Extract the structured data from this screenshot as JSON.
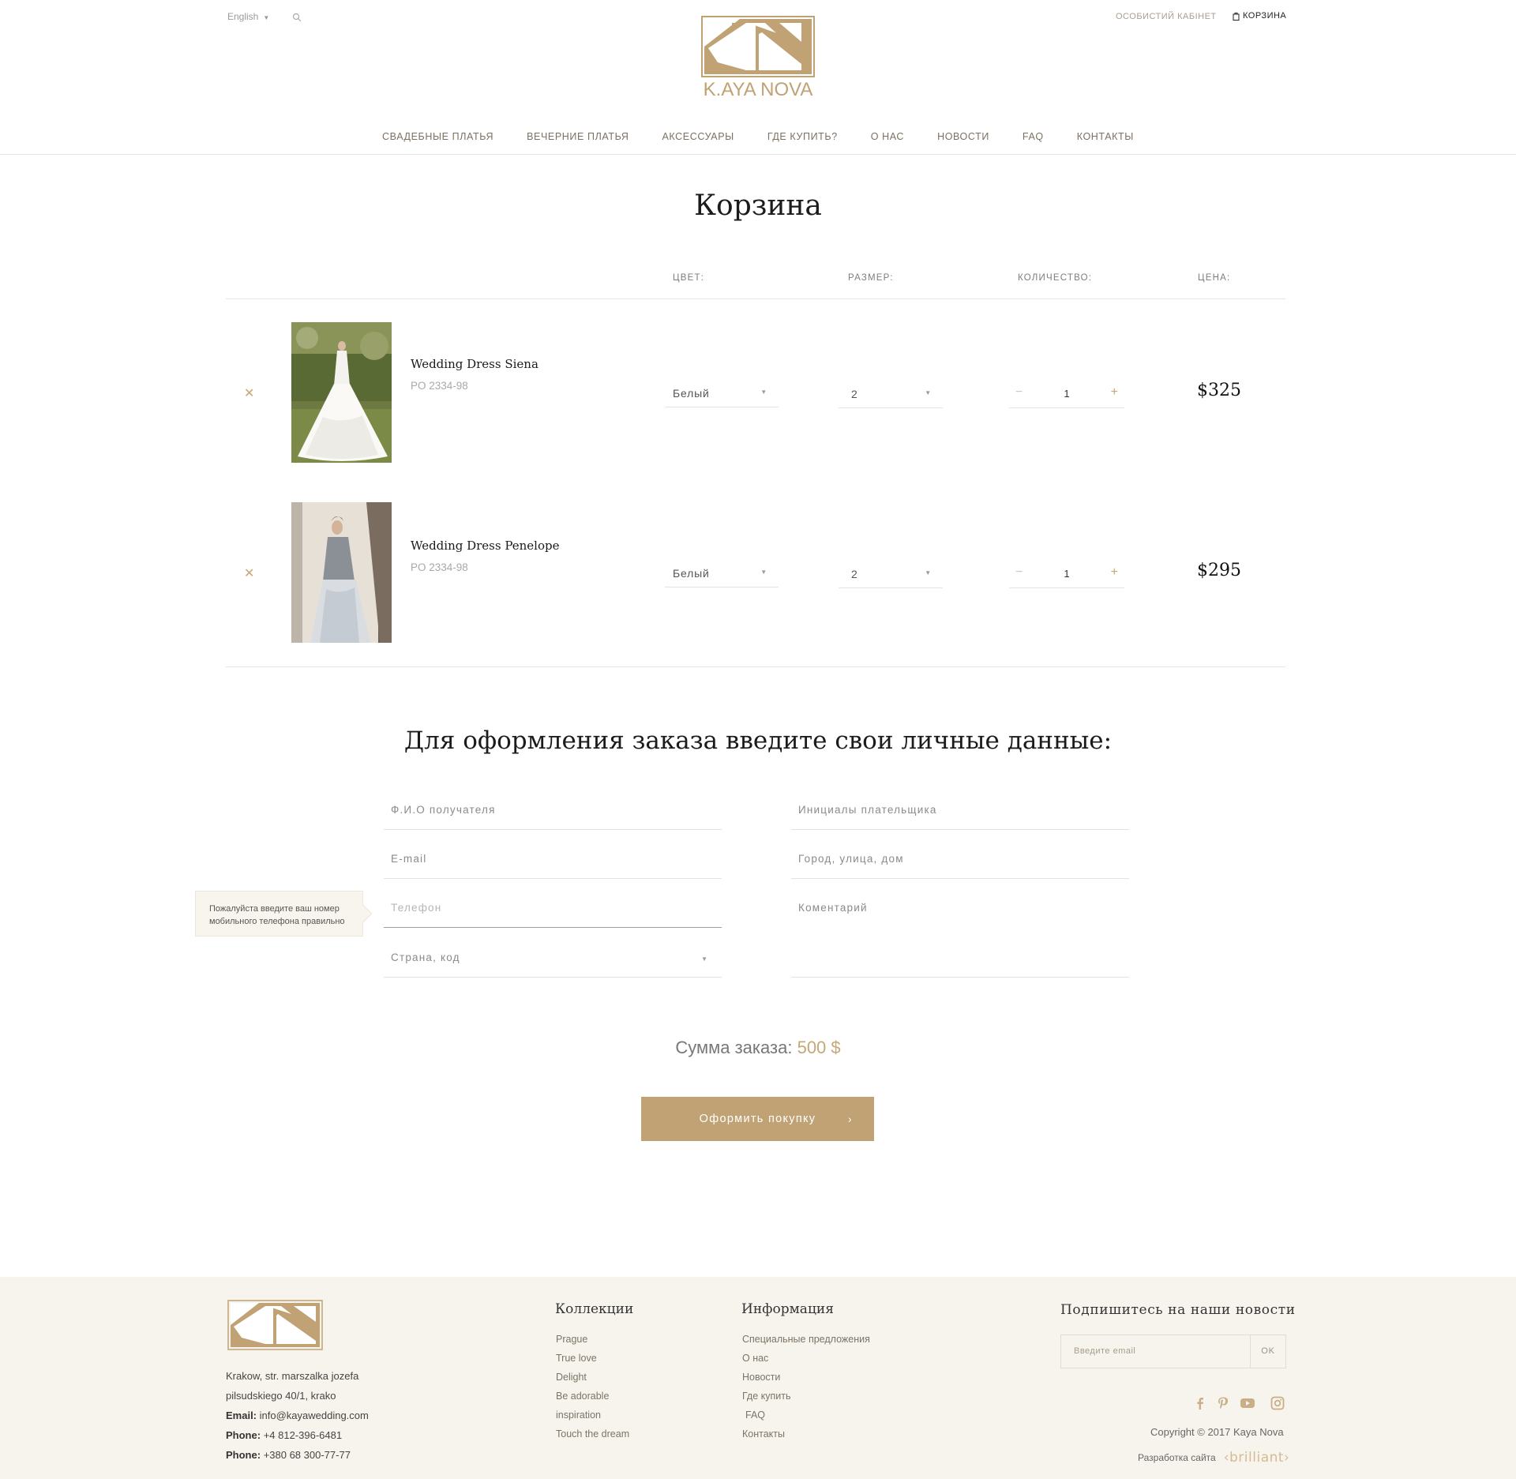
{
  "header": {
    "language": "English",
    "cabinet_link": "ОСОБИСТИЙ КАБІНЕТ",
    "cart_link": "КОРЗИНА",
    "logo_text": "KayaNova",
    "nav": [
      "СВАДЕБНЫЕ ПЛАТЬЯ",
      "ВЕЧЕРНИЕ ПЛАТЬЯ",
      "АКСЕССУАРЫ",
      "ГДЕ КУПИТЬ?",
      "О НАС",
      "НОВОСТИ",
      "FAQ",
      "КОНТАКТЫ"
    ]
  },
  "cart": {
    "title": "Корзина",
    "columns": {
      "color": "ЦВЕТ:",
      "size": "РАЗМЕР:",
      "quantity": "КОЛИЧЕСТВО:",
      "price": "ЦЕНА:"
    },
    "items": [
      {
        "name": "Wedding Dress Siena",
        "sku": "PO 2334-98",
        "color": "Белый",
        "size": "2",
        "quantity": "1",
        "price": "$325"
      },
      {
        "name": "Wedding Dress Penelope",
        "sku": "PO 2334-98",
        "color": "Белый",
        "size": "2",
        "quantity": "1",
        "price": "$295"
      }
    ]
  },
  "order_form": {
    "title": "Для оформления заказа введите свои личные данные:",
    "fields": {
      "recipient_name": "Ф.И.О получателя",
      "email": "E-mail",
      "phone": "Телефон",
      "country_code": "Страна, код",
      "payer_initials": "Инициалы плательщика",
      "address": "Город, улица, дом",
      "comment": "Коментарий"
    },
    "phone_tooltip": "Пожалуйста введите ваш номер мобильного телефона правильно",
    "sum_label": "Сумма заказа:",
    "sum_value": "500 $",
    "submit_label": "Оформить покупку"
  },
  "footer": {
    "address_line1": "Krakow, str. marszalka jozefa",
    "address_line2": "pilsudskiego 40/1, krako",
    "email_label": "Email:",
    "email_value": "info@kayawedding.com",
    "phone_label": "Phone:",
    "phone1": "+4 812-396-6481",
    "phone2": "+380 68 300-77-77",
    "collections_title": "Коллекции",
    "collections": [
      "Prague",
      "True love",
      "Delight",
      "Be adorable",
      "inspiration",
      "Touch the dream"
    ],
    "info_title": "Информация",
    "info": [
      "Специальные предложения",
      "О нас",
      "Новости",
      "Где купить",
      "FAQ",
      "Контакты"
    ],
    "subscribe_title": "Подпишитесь на наши новости",
    "subscribe_placeholder": "Введите email",
    "subscribe_button": "OK",
    "copyright": "Copyright © 2017 Kaya Nova",
    "developer_label": "Разработка сайта",
    "developer_brand": "‹brilliant›"
  },
  "colors": {
    "accent": "#c0a274",
    "footer_bg": "#f7f4ed"
  }
}
